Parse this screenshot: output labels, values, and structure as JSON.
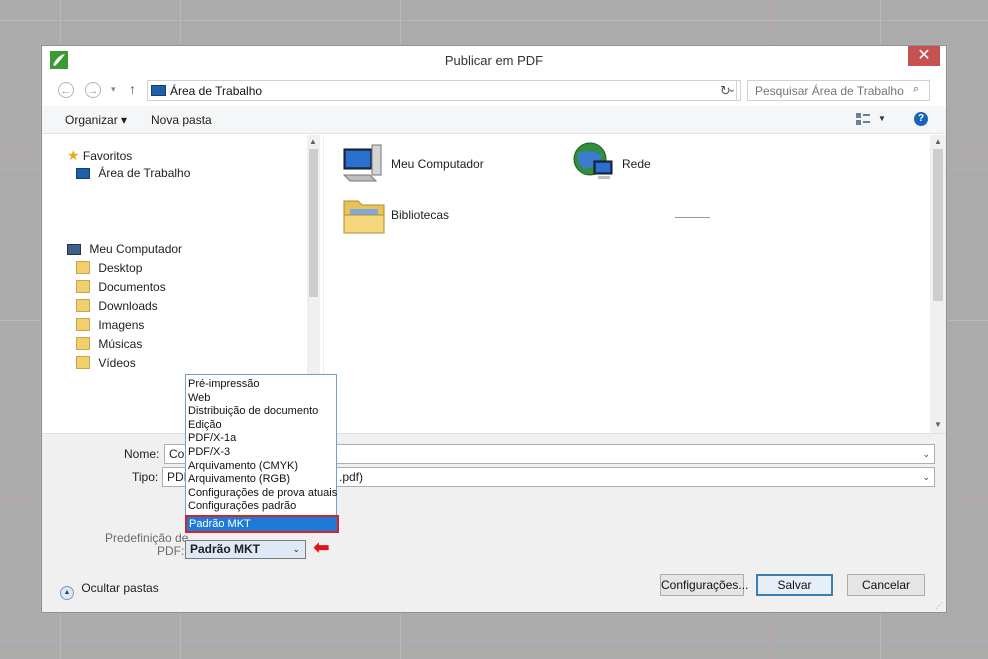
{
  "window": {
    "title": "Publicar em PDF",
    "close_glyph": "✕"
  },
  "nav": {
    "address": "Área de Trabalho",
    "search_placeholder": "Pesquisar Área de Trabalho"
  },
  "toolbar": {
    "organize": "Organizar ▾",
    "new_folder": "Nova pasta",
    "help_glyph": "?"
  },
  "tree": {
    "favorites": "Favoritos",
    "desktop_fav": "Área de Trabalho",
    "computer": "Meu Computador",
    "items": [
      "Desktop",
      "Documentos",
      "Downloads",
      "Imagens",
      "Músicas",
      "Vídeos"
    ]
  },
  "content": {
    "items": [
      "Meu Computador",
      "Rede",
      "Bibliotecas"
    ]
  },
  "form": {
    "name_label": "Nome:",
    "name_value": "Co",
    "type_label": "Tipo:",
    "type_value_left": "PDF",
    "type_value_right": ".pdf)",
    "preset_label_1": "Predefinição de",
    "preset_label_2": "PDF:",
    "preset_value": "Padrão MKT"
  },
  "dropdown": {
    "options": [
      "Pré-impressão",
      "Web",
      "Distribuição de documento",
      "Edição",
      "PDF/X-1a",
      "PDF/X-3",
      "Arquivamento (CMYK)",
      "Arquivamento (RGB)",
      "Configurações de prova atuais",
      "Configurações padrão"
    ],
    "selected": "Padrão MKT"
  },
  "buttons": {
    "hide_folders": "Ocultar pastas",
    "settings": "Configurações...",
    "save": "Salvar",
    "cancel": "Cancelar"
  },
  "colors": {
    "accent": "#1e7ad8",
    "close": "#c75050",
    "highlight_border": "#d3242a",
    "arrow": "#e0141e"
  }
}
